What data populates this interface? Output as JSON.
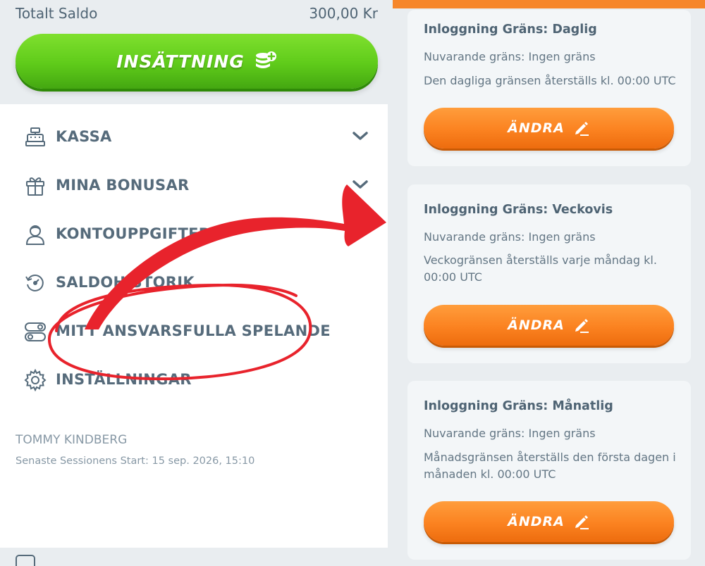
{
  "balance": {
    "label": "Totalt Saldo",
    "value": "300,00 Kr"
  },
  "deposit": {
    "label": "INSÄTTNING",
    "icon": "coins-plus-icon"
  },
  "menu": {
    "items": [
      {
        "label": "KASSA",
        "icon": "cash-register-icon",
        "has_chevron": true
      },
      {
        "label": "MINA BONUSAR",
        "icon": "gift-icon",
        "has_chevron": true
      },
      {
        "label": "KONTOUPPGIFTER",
        "icon": "user-icon",
        "has_chevron": true
      },
      {
        "label": "SALDOHISTORIK",
        "icon": "history-icon",
        "has_chevron": false
      },
      {
        "label": "MITT ANSVARSFULLA SPELANDE",
        "icon": "toggles-icon",
        "has_chevron": false
      },
      {
        "label": "INSTÄLLNINGAR",
        "icon": "gear-icon",
        "has_chevron": false
      }
    ]
  },
  "user": {
    "name": "TOMMY KINDBERG",
    "session": "Senaste Sessionens Start: 15 sep. 2026, 15:10"
  },
  "limits": [
    {
      "title": "Inloggning Gräns: Daglig",
      "current": "Nuvarande gräns: Ingen gräns",
      "reset": "Den dagliga gränsen återställs kl. 00:00 UTC",
      "button": "ÄNDRA"
    },
    {
      "title": "Inloggning Gräns: Veckovis",
      "current": "Nuvarande gräns: Ingen gräns",
      "reset": "Veckogränsen återställs varje måndag kl. 00:00 UTC",
      "button": "ÄNDRA"
    },
    {
      "title": "Inloggning Gräns: Månatlig",
      "current": "Nuvarande gräns: Ingen gräns",
      "reset": "Månadsgränsen återställs den första dagen i månaden kl. 00:00 UTC",
      "button": "ÄNDRA"
    }
  ],
  "colors": {
    "green_button": "#5fcb1a",
    "orange_button": "#fb8220",
    "text_primary": "#4f6474",
    "annotation_red": "#e8232c"
  }
}
